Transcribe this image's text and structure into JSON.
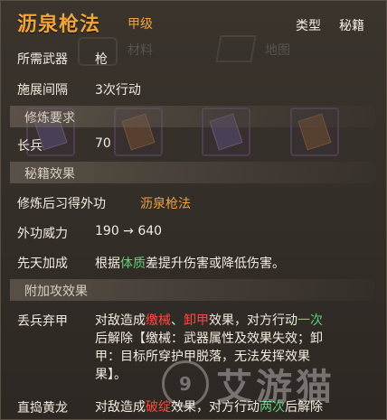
{
  "header": {
    "title": "沥泉枪法",
    "grade": "甲级",
    "type_label": "类型",
    "type_value": "秘籍"
  },
  "background": {
    "materials_label": "材料",
    "map_label": "地图"
  },
  "basic": {
    "weapon_label": "所需武器",
    "weapon_value": "枪",
    "interval_label": "施展间隔",
    "interval_value": "3次行动"
  },
  "requirements": {
    "section_title": "修炼要求",
    "skill_label": "长兵",
    "skill_value": "70"
  },
  "effects": {
    "section_title": "秘籍效果",
    "learn_label": "修炼后习得外功",
    "learn_value": "沥泉枪法",
    "power_label": "外功威力",
    "power_value": "190 → 640",
    "innate_label": "先天加成",
    "innate_prefix": "根据",
    "innate_attr": "体质",
    "innate_suffix": "差提升伤害或降低伤害。"
  },
  "extra": {
    "section_title": "附加攻效果",
    "skills": [
      {
        "name": "丢兵弃甲",
        "line1_prefix": "对敌造成",
        "line1_red1": "缴械",
        "line1_sep": "、",
        "line1_red2": "卸甲",
        "line1_mid": "效果，对方行动",
        "line1_green": "一次",
        "line2": "后解除【缴械：武器属性及效果失效；卸",
        "line3": "甲：目标所穿护甲脱落，无法发挥效果",
        "line4": "果】。"
      },
      {
        "name": "直捣黄龙",
        "line1_prefix": "对敌造成",
        "line1_red": "破绽",
        "line1_mid": "效果，对方行动",
        "line1_green": "两次",
        "line1_suffix": "后解除"
      }
    ]
  },
  "watermark": {
    "badge": "9",
    "text": "艾游猫"
  }
}
